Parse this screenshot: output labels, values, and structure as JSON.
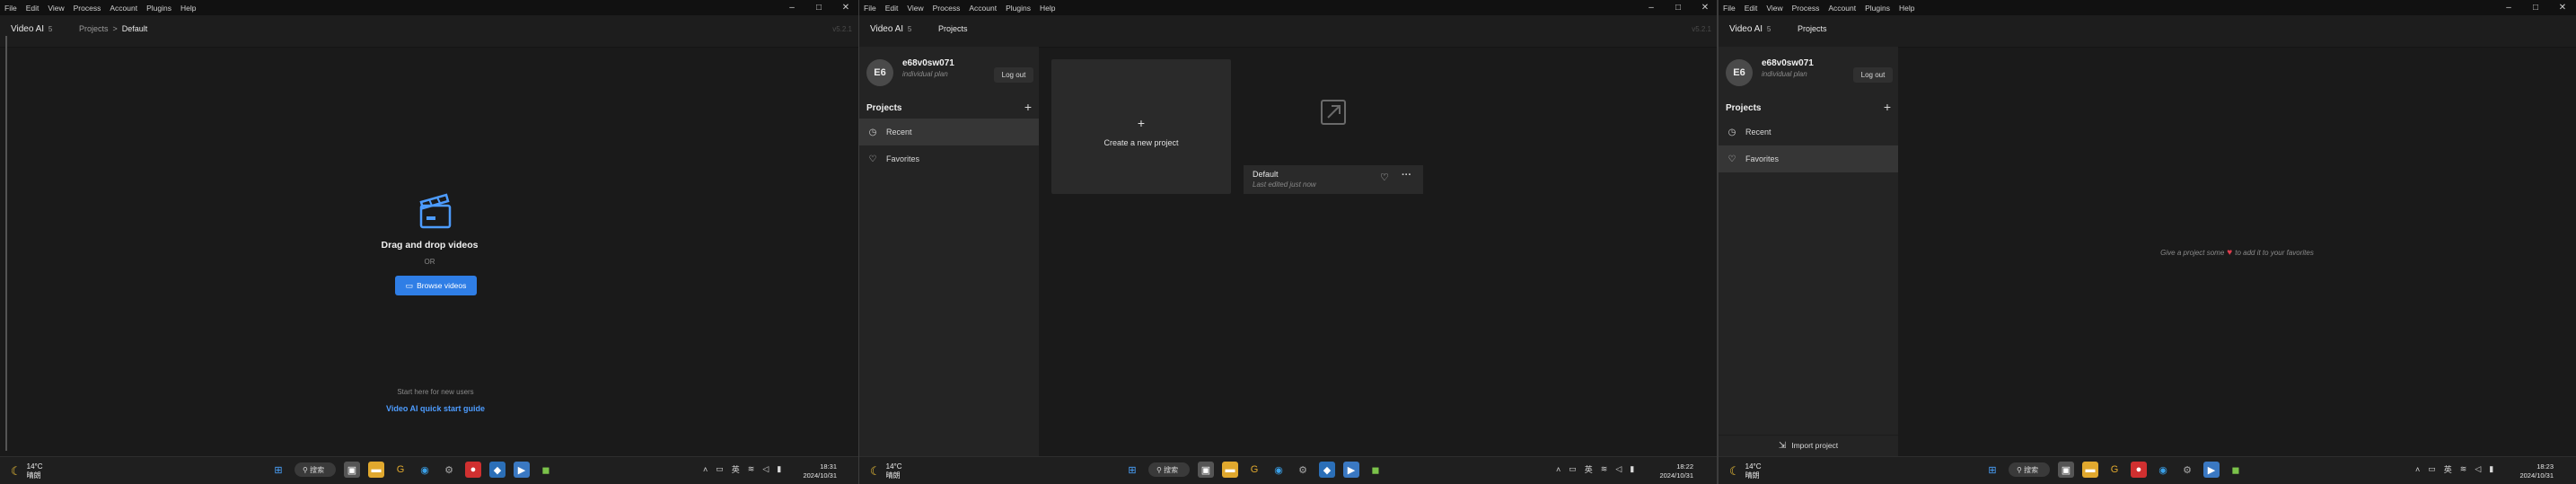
{
  "menu": [
    "File",
    "Edit",
    "View",
    "Process",
    "Account",
    "Plugins",
    "Help"
  ],
  "window_controls": {
    "min": "–",
    "max": "□",
    "close": "✕"
  },
  "app": {
    "name": "Video AI",
    "version": "5",
    "corner_version": "v5.2.1"
  },
  "panel1": {
    "breadcrumb": {
      "root": "Projects",
      "sep": ">",
      "current": "Default"
    },
    "drag_title": "Drag and drop videos",
    "or": "OR",
    "browse_label": "Browse videos",
    "start_text": "Start here for new users",
    "guide_link": "Video AI quick start guide"
  },
  "panel2": {
    "nav_title": "Projects",
    "user": {
      "initials": "E6",
      "name": "e68v0sw071",
      "plan": "individual plan",
      "logout": "Log out"
    },
    "projects_heading": "Projects",
    "nav": [
      {
        "label": "Recent",
        "active": true
      },
      {
        "label": "Favorites",
        "active": false
      }
    ],
    "new_project": "Create a new project",
    "project": {
      "name": "Default",
      "edited": "Last edited just now"
    }
  },
  "panel3": {
    "nav_title": "Projects",
    "user": {
      "initials": "E6",
      "name": "e68v0sw071",
      "plan": "individual plan",
      "logout": "Log out"
    },
    "projects_heading": "Projects",
    "nav": [
      {
        "label": "Recent",
        "active": false
      },
      {
        "label": "Favorites",
        "active": true
      }
    ],
    "fav_before": "Give a project some",
    "fav_after": "to add it to your favorites",
    "import": "Import project"
  },
  "taskbars": [
    {
      "temp": "14°C",
      "cond": "晴朗",
      "search": "搜索",
      "time": "18:31",
      "date": "2024/10/31"
    },
    {
      "temp": "14°C",
      "cond": "晴朗",
      "search": "搜索",
      "time": "18:22",
      "date": "2024/10/31"
    },
    {
      "temp": "14°C",
      "cond": "晴朗",
      "search": "搜索",
      "time": "18:23",
      "date": "2024/10/31"
    }
  ],
  "colors": {
    "accent": "#2f7ee6",
    "link": "#4d9cff",
    "heart": "#e23c4d"
  }
}
